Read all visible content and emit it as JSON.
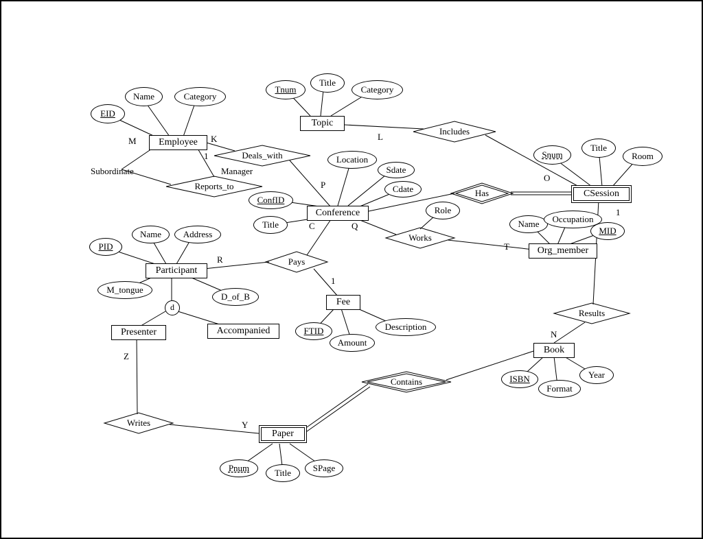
{
  "entities": {
    "employee": "Employee",
    "topic": "Topic",
    "conference": "Conference",
    "csession": "CSession",
    "org_member": "Org_member",
    "participant": "Participant",
    "presenter": "Presenter",
    "accompanied": "Accompanied",
    "fee": "Fee",
    "book": "Book",
    "paper": "Paper"
  },
  "relationships": {
    "reports_to": "Reports_to",
    "deals_with": "Deals_with",
    "includes": "Includes",
    "has": "Has",
    "works": "Works",
    "pays": "Pays",
    "results": "Results",
    "contains": "Contains",
    "writes": "Writes"
  },
  "attributes": {
    "employee": {
      "eid": "EID",
      "name": "Name",
      "category": "Category"
    },
    "topic": {
      "tnum": "Tnum",
      "title": "Title",
      "category": "Category"
    },
    "csession": {
      "snum": "Snum",
      "title": "Title",
      "room": "Room"
    },
    "conference": {
      "confid": "ConfID",
      "title": "Title",
      "location": "Location",
      "sdate": "Sdate",
      "cdate": "Cdate"
    },
    "works": {
      "role": "Role"
    },
    "org_member": {
      "name": "Name",
      "occupation": "Occupation",
      "mid": "MID"
    },
    "participant": {
      "pid": "PID",
      "name": "Name",
      "address": "Address",
      "m_tongue": "M_tongue",
      "d_of_b": "D_of_B"
    },
    "fee": {
      "ftid": "FTID",
      "amount": "Amount",
      "description": "Description"
    },
    "book": {
      "isbn": "ISBN",
      "year": "Year",
      "format": "Format"
    },
    "paper": {
      "pnum": "Pnum",
      "title": "Title",
      "spage": "SPage"
    }
  },
  "cardinality": {
    "M": "M",
    "K": "K",
    "one": "1",
    "subordinate": "Subordinate",
    "manager": "Manager",
    "P": "P",
    "L": "L",
    "O": "O",
    "C": "C",
    "Q": "Q",
    "T": "T",
    "R": "R",
    "Z": "Z",
    "Y": "Y",
    "N": "N",
    "d": "d"
  }
}
